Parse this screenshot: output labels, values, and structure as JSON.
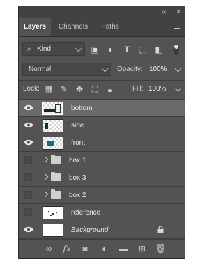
{
  "tabs": [
    {
      "label": "Layers",
      "active": true
    },
    {
      "label": "Channels",
      "active": false
    },
    {
      "label": "Paths",
      "active": false
    }
  ],
  "filter": {
    "kind_label": "Kind"
  },
  "blend": {
    "mode": "Normal",
    "opacity_label": "Opacity:",
    "opacity_value": "100%"
  },
  "lock": {
    "label": "Lock:",
    "fill_label": "Fill:",
    "fill_value": "100%"
  },
  "layers": [
    {
      "name": "bottom",
      "visible": true,
      "selected": true,
      "type": "pixel"
    },
    {
      "name": "side",
      "visible": true,
      "selected": false,
      "type": "pixel"
    },
    {
      "name": "front",
      "visible": true,
      "selected": false,
      "type": "pixel"
    },
    {
      "name": "box 1",
      "visible": false,
      "selected": false,
      "type": "group"
    },
    {
      "name": "box 3",
      "visible": false,
      "selected": false,
      "type": "group"
    },
    {
      "name": "box 2",
      "visible": false,
      "selected": false,
      "type": "group"
    },
    {
      "name": "reference",
      "visible": false,
      "selected": false,
      "type": "pixel"
    },
    {
      "name": "Background",
      "visible": true,
      "selected": false,
      "type": "background",
      "locked": true
    }
  ],
  "footer": {
    "fx_label": "fx"
  },
  "colors": {
    "panel": "#535353",
    "header": "#424242",
    "selected_row": "#6a6a6a",
    "text": "#ececec"
  }
}
